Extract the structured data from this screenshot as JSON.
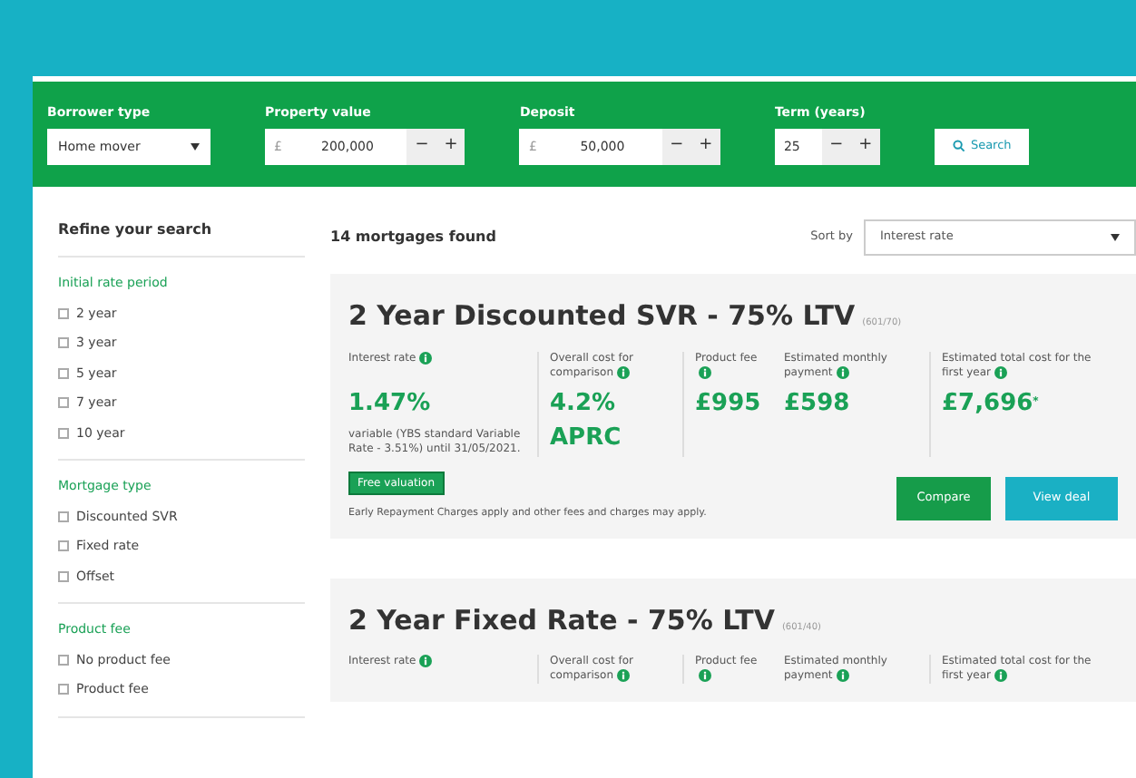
{
  "search_bar": {
    "fields": [
      {
        "kind": "select",
        "label": "Borrower type",
        "value": "Home mover"
      },
      {
        "kind": "stepper",
        "label": "Property value",
        "prefix": "£",
        "value": "200,000",
        "minus": "−",
        "plus": "+"
      },
      {
        "kind": "stepper",
        "label": "Deposit",
        "prefix": "£",
        "value": "50,000",
        "minus": "−",
        "plus": "+"
      },
      {
        "kind": "stepper",
        "label": "Term (years)",
        "value": "25",
        "minus": "−",
        "plus": "+"
      }
    ],
    "search_button": "Search"
  },
  "sidebar": {
    "title": "Refine your search",
    "groups": [
      {
        "heading": "Initial rate period",
        "options": [
          {
            "label": "2 year",
            "checked": false
          },
          {
            "label": "3 year",
            "checked": false
          },
          {
            "label": "5 year",
            "checked": false
          },
          {
            "label": "7 year",
            "checked": false
          },
          {
            "label": "10 year",
            "checked": false
          }
        ]
      },
      {
        "heading": "Mortgage type",
        "options": [
          {
            "label": "Discounted SVR",
            "checked": false
          },
          {
            "label": "Fixed rate",
            "checked": false
          },
          {
            "label": "Offset",
            "checked": false
          }
        ]
      },
      {
        "heading": "Product fee",
        "options": [
          {
            "label": "No product fee",
            "checked": false
          },
          {
            "label": "Product fee",
            "checked": false
          }
        ]
      }
    ]
  },
  "results": {
    "count": "14 mortgages found",
    "sort_label": "Sort by",
    "sort_value": "Interest rate"
  },
  "mortgages": [
    {
      "title": "2 Year Discounted SVR - 75% LTV",
      "code": "(601/70)",
      "columns": [
        {
          "label": "Interest rate",
          "value": "1.47%",
          "note": "variable (YBS standard Variable Rate - 3.51%) until 31/05/2021."
        },
        {
          "label": "Overall cost for comparison",
          "value": "4.2%",
          "note": "APRC"
        },
        {
          "label": "Product fee",
          "value": "£995"
        },
        {
          "label": "Estimated monthly payment",
          "value": "£598"
        },
        {
          "label": "Estimated total cost for the first year",
          "value": "£7,696",
          "mark": "*"
        }
      ],
      "badge": "Free valuation",
      "disclaimer": "Early Repayment Charges apply and other fees and charges may apply.",
      "buttons": [
        "Compare",
        "View deal"
      ]
    },
    {
      "title": "2 Year Fixed Rate - 75% LTV",
      "code": "(601/40)",
      "columns": [
        {
          "label": "Interest rate"
        },
        {
          "label": "Overall cost for comparison"
        },
        {
          "label": "Product fee"
        },
        {
          "label": "Estimated monthly payment"
        },
        {
          "label": "Estimated total cost for the first year"
        }
      ]
    }
  ]
}
